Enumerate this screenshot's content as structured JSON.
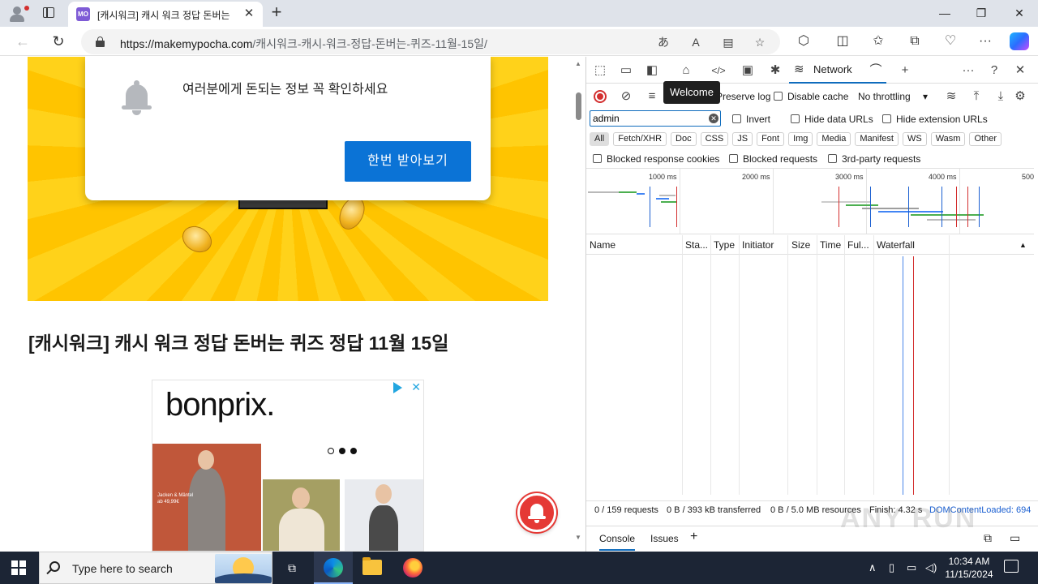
{
  "browser": {
    "tab_title": "[캐시워크] 캐시 워크 정답 돈버는",
    "tab_favicon_text": "MO",
    "url_host": "https://makemypocha.com",
    "url_path": "/캐시워크-캐시-워크-정답-돈버는-퀴즈-11월-15일/",
    "icons": [
      "profile-icon",
      "tab-actions-icon",
      "close-icon",
      "new-tab-icon",
      "minimize-icon",
      "maximize-icon",
      "back-icon",
      "refresh-icon",
      "lock-icon",
      "translate-icon",
      "read-aloud-icon",
      "immersive-reader-icon",
      "favorite-icon",
      "extensions-icon",
      "split-screen-icon",
      "favorites-icon",
      "collections-icon",
      "browser-essentials-icon",
      "more-icon",
      "copilot-icon"
    ],
    "glyphs": {
      "close": "✕",
      "new_tab": "+",
      "minimize": "—",
      "maximize": "❐",
      "back": "←",
      "refresh": "↻",
      "translate": "あ",
      "read_aloud": "A",
      "immersive": "▤",
      "star": "☆",
      "extensions": "⬡",
      "split": "◫",
      "favorites": "✩",
      "collections": "⧉",
      "essentials": "♡",
      "more": "···"
    }
  },
  "page": {
    "popup_message": "여러분에게 돈되는 정보 꼭 확인하세요",
    "popup_button": "한번 받아보기",
    "article_title": "[캐시워크] 캐시 워크 정답 돈버는 퀴즈 정답 11월 15일",
    "ad": {
      "brand": "bonprix.",
      "caption": "Jacken & Mäntel\nab 49,99€",
      "choices_close": "✕"
    },
    "colors": {
      "hero_yellow": "#ffc400",
      "button_blue": "#0b73d6",
      "notify_red": "#e53935"
    }
  },
  "devtools": {
    "tabs": [
      {
        "name": "inspect",
        "glyph": "⬚"
      },
      {
        "name": "device-emulation",
        "glyph": "▭"
      },
      {
        "name": "dock",
        "glyph": "◧"
      },
      {
        "name": "welcome",
        "glyph": "⌂"
      },
      {
        "name": "elements",
        "glyph": "</>"
      },
      {
        "name": "console",
        "glyph": "▣"
      },
      {
        "name": "sources",
        "glyph": "✱"
      }
    ],
    "network_label": "Network",
    "tooltip": "Welcome",
    "toolbar": {
      "preserve_log": "Preserve log",
      "disable_cache": "Disable cache",
      "throttling": "No throttling"
    },
    "filter": {
      "value": "admin",
      "invert": "Invert",
      "hide_data_urls": "Hide data URLs",
      "hide_extension_urls": "Hide extension URLs"
    },
    "chips": [
      "All",
      "Fetch/XHR",
      "Doc",
      "CSS",
      "JS",
      "Font",
      "Img",
      "Media",
      "Manifest",
      "WS",
      "Wasm",
      "Other"
    ],
    "blocked": {
      "blocked_cookies": "Blocked response cookies",
      "blocked_requests": "Blocked requests",
      "third_party": "3rd-party requests"
    },
    "overview_ticks": [
      "1000 ms",
      "2000 ms",
      "3000 ms",
      "4000 ms",
      "500"
    ],
    "columns": [
      "Name",
      "Sta...",
      "Type",
      "Initiator",
      "Size",
      "Time",
      "Ful...",
      "Waterfall"
    ],
    "status": {
      "requests": "0 / 159 requests",
      "transferred": "0 B / 393 kB transferred",
      "resources": "0 B / 5.0 MB resources",
      "finish": "Finish: 4.32 s",
      "dom_loaded": "DOMContentLoaded: 694"
    },
    "drawer_tabs": [
      "Console",
      "Issues"
    ],
    "drawer_add": "+"
  },
  "watermark": "ANY RUN",
  "taskbar": {
    "search_placeholder": "Type here to search",
    "time": "10:34 AM",
    "date": "11/15/2024",
    "tray_chevron": "∧"
  }
}
